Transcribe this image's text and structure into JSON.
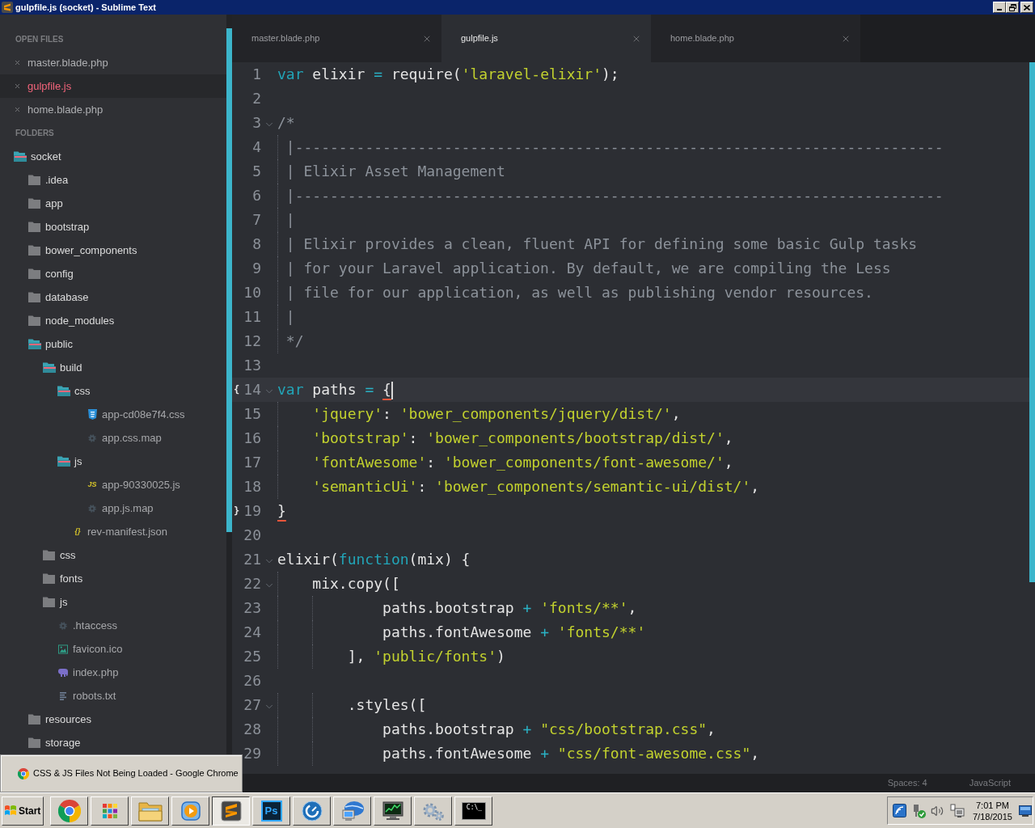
{
  "window": {
    "title": "gulpfile.js (socket) - Sublime Text"
  },
  "sidebar": {
    "open_files_header": "OPEN FILES",
    "open_files": [
      {
        "name": "master.blade.php",
        "selected": false
      },
      {
        "name": "gulpfile.js",
        "selected": true
      },
      {
        "name": "home.blade.php",
        "selected": false
      }
    ],
    "folders_header": "FOLDERS",
    "folders": [
      {
        "name": "socket",
        "kind": "folder",
        "expanded": true,
        "children": [
          {
            "name": ".idea",
            "kind": "folder",
            "expanded": false
          },
          {
            "name": "app",
            "kind": "folder",
            "expanded": false
          },
          {
            "name": "bootstrap",
            "kind": "folder",
            "expanded": false
          },
          {
            "name": "bower_components",
            "kind": "folder",
            "expanded": false
          },
          {
            "name": "config",
            "kind": "folder",
            "expanded": false
          },
          {
            "name": "database",
            "kind": "folder",
            "expanded": false
          },
          {
            "name": "node_modules",
            "kind": "folder",
            "expanded": false
          },
          {
            "name": "public",
            "kind": "folder",
            "expanded": true,
            "children": [
              {
                "name": "build",
                "kind": "folder",
                "expanded": true,
                "children": [
                  {
                    "name": "css",
                    "kind": "folder",
                    "expanded": true,
                    "children": [
                      {
                        "name": "app-cd08e7f4.css",
                        "kind": "css"
                      },
                      {
                        "name": "app.css.map",
                        "kind": "config"
                      }
                    ]
                  },
                  {
                    "name": "js",
                    "kind": "folder",
                    "expanded": true,
                    "children": [
                      {
                        "name": "app-90330025.js",
                        "kind": "js",
                        "badge": "JS"
                      },
                      {
                        "name": "app.js.map",
                        "kind": "config"
                      }
                    ]
                  },
                  {
                    "name": "rev-manifest.json",
                    "kind": "json",
                    "badge": "{}"
                  }
                ]
              },
              {
                "name": "css",
                "kind": "folder",
                "expanded": false
              },
              {
                "name": "fonts",
                "kind": "folder",
                "expanded": false
              },
              {
                "name": "js",
                "kind": "folder",
                "expanded": false
              },
              {
                "name": ".htaccess",
                "kind": "config"
              },
              {
                "name": "favicon.ico",
                "kind": "image"
              },
              {
                "name": "index.php",
                "kind": "php"
              },
              {
                "name": "robots.txt",
                "kind": "text"
              }
            ]
          },
          {
            "name": "resources",
            "kind": "folder",
            "expanded": false
          },
          {
            "name": "storage",
            "kind": "folder",
            "expanded": false
          }
        ]
      }
    ]
  },
  "tabs": [
    {
      "label": "master.blade.php",
      "selected": false
    },
    {
      "label": "gulpfile.js",
      "selected": true
    },
    {
      "label": "home.blade.php",
      "selected": false
    }
  ],
  "editor": {
    "lines": [
      {
        "number": "1",
        "fold": false,
        "current": false,
        "tokens": [
          {
            "kind": "keyword",
            "text": "var"
          },
          {
            "kind": "plain",
            "text": " elixir "
          },
          {
            "kind": "operator",
            "text": "= "
          },
          {
            "kind": "plain",
            "text": "require("
          },
          {
            "kind": "string",
            "text": "'laravel-elixir'"
          },
          {
            "kind": "plain",
            "text": ");"
          }
        ]
      },
      {
        "number": "2",
        "fold": false,
        "current": false
      },
      {
        "number": "3",
        "fold": true,
        "current": false,
        "tokens": [
          {
            "kind": "comment",
            "text": "/*"
          }
        ]
      },
      {
        "number": "4",
        "fold": false,
        "current": false,
        "tokens": [
          {
            "kind": "comment",
            "text": " |--------------------------------------------------------------------------"
          }
        ]
      },
      {
        "number": "5",
        "fold": false,
        "current": false,
        "tokens": [
          {
            "kind": "comment",
            "text": " | Elixir Asset Management"
          }
        ]
      },
      {
        "number": "6",
        "fold": false,
        "current": false,
        "tokens": [
          {
            "kind": "comment",
            "text": " |--------------------------------------------------------------------------"
          }
        ]
      },
      {
        "number": "7",
        "fold": false,
        "current": false,
        "tokens": [
          {
            "kind": "comment",
            "text": " |"
          }
        ]
      },
      {
        "number": "8",
        "fold": false,
        "current": false,
        "tokens": [
          {
            "kind": "comment",
            "text": " | Elixir provides a clean, fluent API for defining some basic Gulp tasks"
          }
        ]
      },
      {
        "number": "9",
        "fold": false,
        "current": false,
        "tokens": [
          {
            "kind": "comment",
            "text": " | for your Laravel application. By default, we are compiling the Less"
          }
        ]
      },
      {
        "number": "10",
        "fold": false,
        "current": false,
        "tokens": [
          {
            "kind": "comment",
            "text": " | file for our application, as well as publishing vendor resources."
          }
        ]
      },
      {
        "number": "11",
        "fold": false,
        "current": false,
        "tokens": [
          {
            "kind": "comment",
            "text": " |"
          }
        ]
      },
      {
        "number": "12",
        "fold": false,
        "current": false,
        "tokens": [
          {
            "kind": "comment",
            "text": " */"
          }
        ]
      },
      {
        "number": "13",
        "fold": false,
        "current": false
      },
      {
        "number": "14",
        "fold": true,
        "current": true,
        "mark": "{",
        "tokens": [
          {
            "kind": "keyword",
            "text": "var"
          },
          {
            "kind": "plain",
            "text": " paths "
          },
          {
            "kind": "operator",
            "text": "= "
          },
          {
            "kind": "match",
            "text": "{"
          }
        ]
      },
      {
        "number": "15",
        "fold": false,
        "current": false,
        "tokens": [
          {
            "kind": "string",
            "text": "    'jquery'"
          },
          {
            "kind": "plain",
            "text": ": "
          },
          {
            "kind": "string",
            "text": "'bower_components/jquery/dist/'"
          },
          {
            "kind": "plain",
            "text": ","
          }
        ]
      },
      {
        "number": "16",
        "fold": false,
        "current": false,
        "tokens": [
          {
            "kind": "string",
            "text": "    'bootstrap'"
          },
          {
            "kind": "plain",
            "text": ": "
          },
          {
            "kind": "string",
            "text": "'bower_components/bootstrap/dist/'"
          },
          {
            "kind": "plain",
            "text": ","
          }
        ]
      },
      {
        "number": "17",
        "fold": false,
        "current": false,
        "tokens": [
          {
            "kind": "string",
            "text": "    'fontAwesome'"
          },
          {
            "kind": "plain",
            "text": ": "
          },
          {
            "kind": "string",
            "text": "'bower_components/font-awesome/'"
          },
          {
            "kind": "plain",
            "text": ","
          }
        ]
      },
      {
        "number": "18",
        "fold": false,
        "current": false,
        "tokens": [
          {
            "kind": "string",
            "text": "    'semanticUi'"
          },
          {
            "kind": "plain",
            "text": ": "
          },
          {
            "kind": "string",
            "text": "'bower_components/semantic-ui/dist/'"
          },
          {
            "kind": "plain",
            "text": ","
          }
        ]
      },
      {
        "number": "19",
        "fold": false,
        "current": false,
        "mark": "}",
        "tokens": [
          {
            "kind": "match",
            "text": "}"
          }
        ]
      },
      {
        "number": "20",
        "fold": false,
        "current": false
      },
      {
        "number": "21",
        "fold": true,
        "current": false,
        "tokens": [
          {
            "kind": "plain",
            "text": "elixir("
          },
          {
            "kind": "keyword",
            "text": "function"
          },
          {
            "kind": "plain",
            "text": "(mix) {"
          }
        ]
      },
      {
        "number": "22",
        "fold": true,
        "current": false,
        "tokens": [
          {
            "kind": "plain",
            "text": "    mix.copy(["
          }
        ]
      },
      {
        "number": "23",
        "fold": false,
        "current": false,
        "tokens": [
          {
            "kind": "plain",
            "text": "            paths.bootstrap "
          },
          {
            "kind": "operator",
            "text": "+ "
          },
          {
            "kind": "string",
            "text": "'fonts/**'"
          },
          {
            "kind": "plain",
            "text": ","
          }
        ]
      },
      {
        "number": "24",
        "fold": false,
        "current": false,
        "tokens": [
          {
            "kind": "plain",
            "text": "            paths.fontAwesome "
          },
          {
            "kind": "operator",
            "text": "+ "
          },
          {
            "kind": "string",
            "text": "'fonts/**'"
          }
        ]
      },
      {
        "number": "25",
        "fold": false,
        "current": false,
        "tokens": [
          {
            "kind": "plain",
            "text": "        ], "
          },
          {
            "kind": "string",
            "text": "'public/fonts'"
          },
          {
            "kind": "plain",
            "text": ")"
          }
        ]
      },
      {
        "number": "26",
        "fold": false,
        "current": false
      },
      {
        "number": "27",
        "fold": true,
        "current": false,
        "tokens": [
          {
            "kind": "plain",
            "text": "        .styles(["
          }
        ]
      },
      {
        "number": "28",
        "fold": false,
        "current": false,
        "tokens": [
          {
            "kind": "plain",
            "text": "            paths.bootstrap "
          },
          {
            "kind": "operator",
            "text": "+ "
          },
          {
            "kind": "string",
            "text": "\"css/bootstrap.css\""
          },
          {
            "kind": "plain",
            "text": ","
          }
        ]
      },
      {
        "number": "29",
        "fold": false,
        "current": false,
        "tokens": [
          {
            "kind": "plain",
            "text": "            paths.fontAwesome "
          },
          {
            "kind": "operator",
            "text": "+ "
          },
          {
            "kind": "string",
            "text": "\"css/font-awesome.css\""
          },
          {
            "kind": "plain",
            "text": ","
          }
        ]
      }
    ]
  },
  "status_bar": {
    "indentation": "Spaces: 4",
    "syntax": "JavaScript"
  },
  "taskbar_tooltip": {
    "title": "CSS & JS Files Not Being Loaded - Google Chrome"
  },
  "taskbar": {
    "start_label": "Start",
    "apps": [
      {
        "kind": "browser",
        "selected": false
      },
      {
        "kind": "launcher",
        "selected": false
      },
      {
        "kind": "files",
        "selected": false
      },
      {
        "kind": "media",
        "selected": false
      },
      {
        "kind": "editor",
        "selected": true
      },
      {
        "kind": "image-editor",
        "label": "Ps",
        "selected": false
      },
      {
        "kind": "gauge",
        "selected": false
      },
      {
        "kind": "network",
        "selected": false
      },
      {
        "kind": "monitor",
        "selected": false
      },
      {
        "kind": "settings",
        "selected": false
      },
      {
        "kind": "terminal",
        "label": "C:\\_",
        "selected": false
      }
    ],
    "clock": {
      "time": "7:01 PM",
      "date": "7/18/2015"
    }
  }
}
